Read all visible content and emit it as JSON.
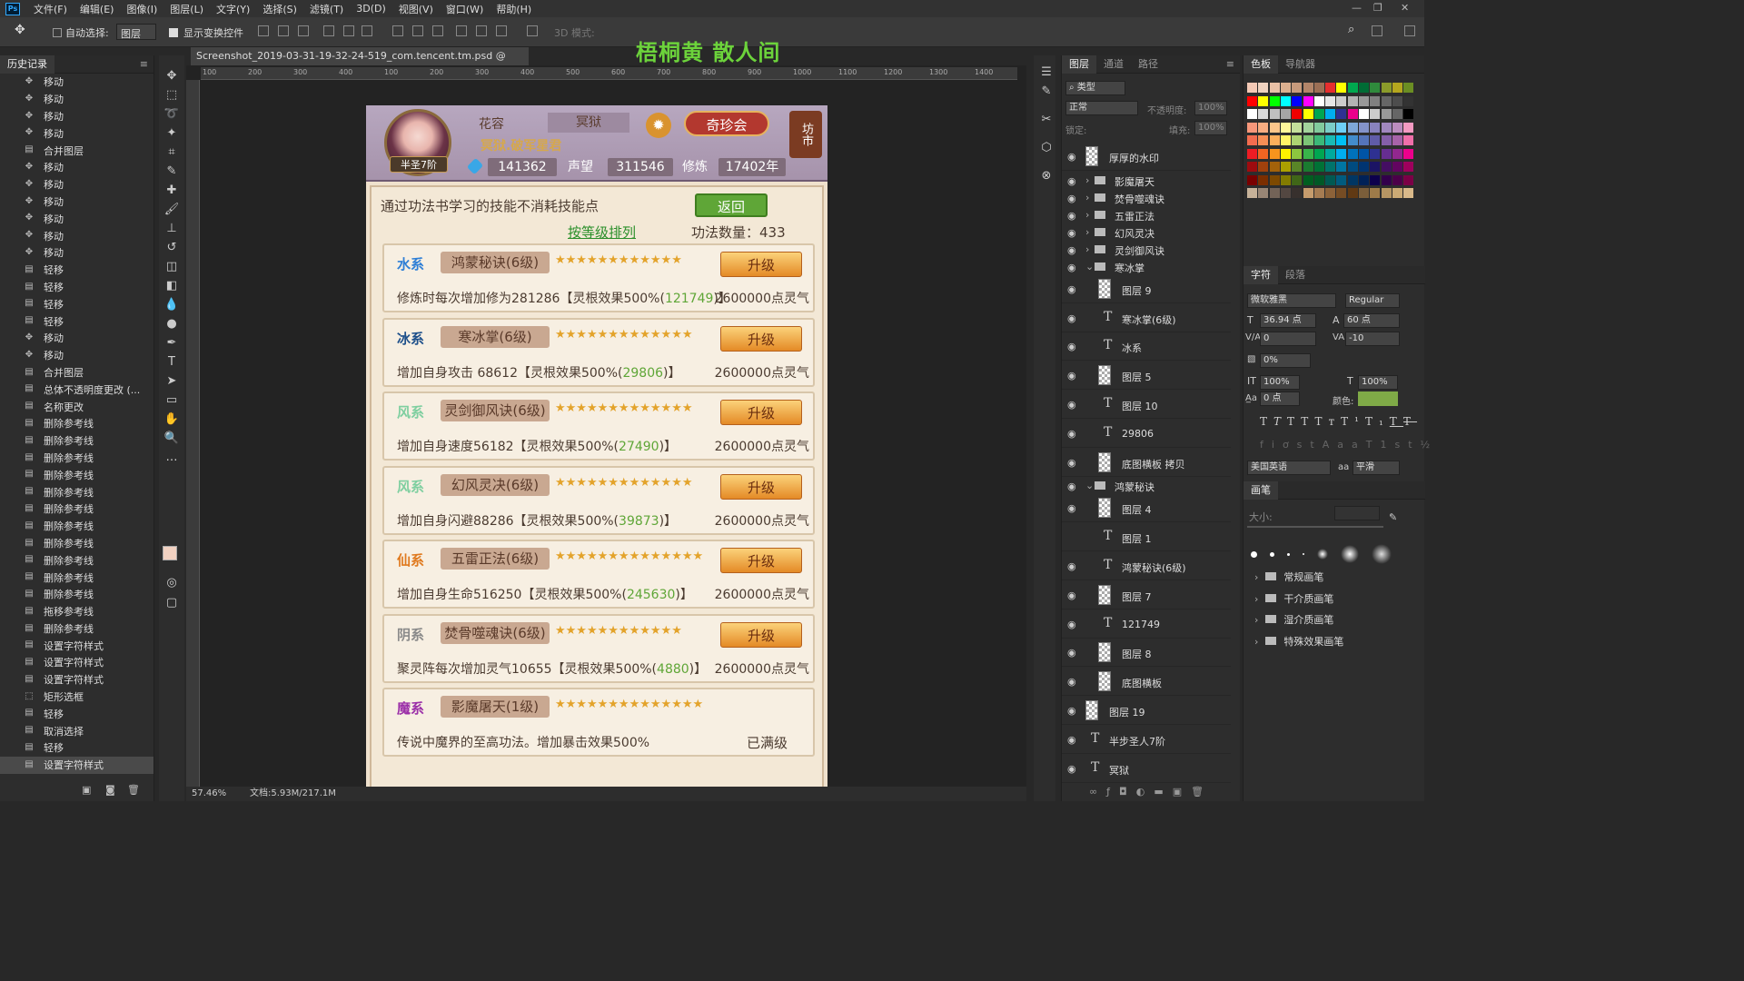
{
  "app": {
    "logo": "Ps"
  },
  "menu": [
    "文件(F)",
    "编辑(E)",
    "图像(I)",
    "图层(L)",
    "文字(Y)",
    "选择(S)",
    "滤镜(T)",
    "3D(D)",
    "视图(V)",
    "窗口(W)",
    "帮助(H)"
  ],
  "window_controls": [
    "—",
    "❐",
    "✕"
  ],
  "options": {
    "auto_select_label": "自动选择:",
    "auto_select_value": "图层",
    "show_transform_label": "显示变换控件",
    "mode_3d_label": "3D 模式:"
  },
  "overlay_watermark": "梧桐黄 散人间",
  "history": {
    "tab": "历史记录",
    "items": [
      {
        "icon": "move",
        "label": "移动"
      },
      {
        "icon": "move",
        "label": "移动"
      },
      {
        "icon": "move",
        "label": "移动"
      },
      {
        "icon": "move",
        "label": "移动"
      },
      {
        "icon": "merge",
        "label": "合并图层"
      },
      {
        "icon": "move",
        "label": "移动"
      },
      {
        "icon": "move",
        "label": "移动"
      },
      {
        "icon": "move",
        "label": "移动"
      },
      {
        "icon": "move",
        "label": "移动"
      },
      {
        "icon": "move",
        "label": "移动"
      },
      {
        "icon": "move",
        "label": "移动"
      },
      {
        "icon": "doc",
        "label": "轻移"
      },
      {
        "icon": "doc",
        "label": "轻移"
      },
      {
        "icon": "doc",
        "label": "轻移"
      },
      {
        "icon": "doc",
        "label": "轻移"
      },
      {
        "icon": "move",
        "label": "移动"
      },
      {
        "icon": "move",
        "label": "移动"
      },
      {
        "icon": "merge",
        "label": "合并图层"
      },
      {
        "icon": "doc",
        "label": "总体不透明度更改 (..."
      },
      {
        "icon": "doc",
        "label": "名称更改"
      },
      {
        "icon": "doc",
        "label": "删除参考线"
      },
      {
        "icon": "doc",
        "label": "删除参考线"
      },
      {
        "icon": "doc",
        "label": "删除参考线"
      },
      {
        "icon": "doc",
        "label": "删除参考线"
      },
      {
        "icon": "doc",
        "label": "删除参考线"
      },
      {
        "icon": "doc",
        "label": "删除参考线"
      },
      {
        "icon": "doc",
        "label": "删除参考线"
      },
      {
        "icon": "doc",
        "label": "删除参考线"
      },
      {
        "icon": "doc",
        "label": "删除参考线"
      },
      {
        "icon": "doc",
        "label": "删除参考线"
      },
      {
        "icon": "doc",
        "label": "删除参考线"
      },
      {
        "icon": "doc",
        "label": "拖移参考线"
      },
      {
        "icon": "doc",
        "label": "删除参考线"
      },
      {
        "icon": "doc",
        "label": "设置字符样式"
      },
      {
        "icon": "doc",
        "label": "设置字符样式"
      },
      {
        "icon": "doc",
        "label": "设置字符样式"
      },
      {
        "icon": "marquee",
        "label": "矩形选框"
      },
      {
        "icon": "doc",
        "label": "轻移"
      },
      {
        "icon": "doc",
        "label": "取消选择"
      },
      {
        "icon": "doc",
        "label": "轻移"
      },
      {
        "icon": "doc",
        "label": "设置字符样式"
      }
    ]
  },
  "document": {
    "tab_title": "Screenshot_2019-03-31-19-32-24-519_com.tencent.tm.psd @ 57.5%(RGB/8) *",
    "close": "×",
    "zoom": "57.46%",
    "doc_size": "文档:5.93M/217.1M",
    "ruler_h": [
      "100",
      "200",
      "300",
      "400",
      "100",
      "200",
      "300",
      "400",
      "500",
      "600",
      "700",
      "800",
      "900",
      "1000",
      "1100",
      "1200",
      "1300",
      "1400"
    ]
  },
  "game": {
    "player_name": "花容",
    "name_box": "冥狱",
    "title": "冥狱.破军星君",
    "realm": "半圣7阶",
    "gem_value": "141362",
    "prestige_label": "声望",
    "prestige_value": "311546",
    "cultivation_label": "修炼",
    "cultivation_value": "17402年",
    "qizhen": "奇珍会",
    "fangshi": "坊市",
    "hint": "通过功法书学习的技能不消耗技能点",
    "back": "返回",
    "sort": "按等级排列",
    "count": "功法数量：433",
    "skills": [
      {
        "elem": "水系",
        "color": "#2f7fd6",
        "name": "鸿蒙秘诀(6级)",
        "stars": "★★★★★★★★★★★★",
        "btn": "升级",
        "desc_a": "修炼时每次增加修为281286【灵根效果500%(",
        "desc_b": "121749",
        "desc_c": ")】",
        "cost": "2600000点灵气"
      },
      {
        "elem": "冰系",
        "color": "#1d4f8a",
        "name": "寒冰掌(6级)",
        "stars": "★★★★★★★★★★★★★",
        "btn": "升级",
        "desc_a": "增加自身攻击 68612【灵根效果500%(",
        "desc_b": "29806",
        "desc_c": ")】",
        "cost": "2600000点灵气"
      },
      {
        "elem": "风系",
        "color": "#7fcfa0",
        "name": "灵剑御风诀(6级)",
        "stars": "★★★★★★★★★★★★★",
        "btn": "升级",
        "desc_a": "增加自身速度56182【灵根效果500%(",
        "desc_b": "27490",
        "desc_c": ")】",
        "cost": "2600000点灵气"
      },
      {
        "elem": "风系",
        "color": "#7fcfa0",
        "name": "幻风灵决(6级)",
        "stars": "★★★★★★★★★★★★★",
        "btn": "升级",
        "desc_a": "增加自身闪避88286【灵根效果500%(",
        "desc_b": "39873",
        "desc_c": ")】",
        "cost": "2600000点灵气"
      },
      {
        "elem": "仙系",
        "color": "#e07a1f",
        "name": "五雷正法(6级)",
        "stars": "★★★★★★★★★★★★★★",
        "btn": "升级",
        "desc_a": "增加自身生命516250【灵根效果500%(",
        "desc_b": "245630",
        "desc_c": ")】",
        "cost": "2600000点灵气"
      },
      {
        "elem": "阴系",
        "color": "#8a8a8a",
        "name": "焚骨噬魂诀(6级)",
        "stars": "★★★★★★★★★★★★",
        "btn": "升级",
        "desc_a": "聚灵阵每次增加灵气10655【灵根效果500%(",
        "desc_b": "4880",
        "desc_c": ")】",
        "cost": "2600000点灵气"
      },
      {
        "elem": "魔系",
        "color": "#9b2fa8",
        "name": "影魔屠天(1级)",
        "stars": "★★★★★★★★★★★★★★",
        "btn": "",
        "desc_a": "传说中魔界的至高功法。增加暴击效果500%",
        "desc_b": "",
        "desc_c": "",
        "cost": "",
        "maxed": "已满级"
      }
    ]
  },
  "layers_panel": {
    "tabs": [
      "图层",
      "通道",
      "路径"
    ],
    "filter": "类型",
    "blend": "正常",
    "opacity_label": "不透明度:",
    "opacity_value": "100%",
    "lock_label": "锁定:",
    "fill_label": "填充:",
    "fill_value": "100%",
    "rows": [
      {
        "kind": "layer",
        "name": "厚厚的水印",
        "depth": 0
      },
      {
        "kind": "group",
        "name": "影魔屠天"
      },
      {
        "kind": "group",
        "name": "焚骨噬魂诀"
      },
      {
        "kind": "group",
        "name": "五雷正法"
      },
      {
        "kind": "group",
        "name": "幻风灵决"
      },
      {
        "kind": "group",
        "name": "灵剑御风诀"
      },
      {
        "kind": "group",
        "name": "寒冰掌",
        "open": true
      },
      {
        "kind": "layer",
        "name": "图层 9",
        "depth": 1
      },
      {
        "kind": "text",
        "name": "寒冰掌(6级)",
        "depth": 1
      },
      {
        "kind": "text",
        "name": "冰系",
        "depth": 1
      },
      {
        "kind": "layer",
        "name": "图层 5",
        "depth": 1
      },
      {
        "kind": "text",
        "name": "图层 10",
        "depth": 1
      },
      {
        "kind": "text",
        "name": "29806",
        "depth": 1
      },
      {
        "kind": "layer",
        "name": "底图横板 拷贝",
        "depth": 1
      },
      {
        "kind": "group",
        "name": "鸿蒙秘诀",
        "open": true
      },
      {
        "kind": "layer",
        "name": "图层 4",
        "depth": 1
      },
      {
        "kind": "text",
        "name": "图层 1",
        "depth": 1,
        "hidden": true
      },
      {
        "kind": "text",
        "name": "鸿蒙秘诀(6级)",
        "depth": 1
      },
      {
        "kind": "layer",
        "name": "图层 7",
        "depth": 1
      },
      {
        "kind": "text",
        "name": "121749",
        "depth": 1
      },
      {
        "kind": "layer",
        "name": "图层 8",
        "depth": 1
      },
      {
        "kind": "layer",
        "name": "底图横板",
        "depth": 1
      },
      {
        "kind": "layer",
        "name": "图层 19",
        "depth": 0
      },
      {
        "kind": "text",
        "name": "半步圣人7阶",
        "depth": 0
      },
      {
        "kind": "text",
        "name": "冥狱",
        "depth": 0
      }
    ]
  },
  "swatches_panel": {
    "tabs": [
      "色板",
      "导航器"
    ]
  },
  "character_panel": {
    "tabs": [
      "字符",
      "段落"
    ],
    "font": "微软雅黑",
    "style": "Regular",
    "size": "36.94 点",
    "leading": "60 点",
    "kerning": "0",
    "tracking": "-10",
    "scale_pct": "0%",
    "vscale": "100%",
    "hscale": "100%",
    "baseline": "0 点",
    "color_label": "颜色:",
    "text_color": "#7faa47",
    "lang": "美国英语",
    "aa_label": "aa",
    "aa": "平滑"
  },
  "brush_panel": {
    "tab": "画笔",
    "size_label": "大小:",
    "folders": [
      "常规画笔",
      "干介质画笔",
      "湿介质画笔",
      "特殊效果画笔"
    ]
  }
}
